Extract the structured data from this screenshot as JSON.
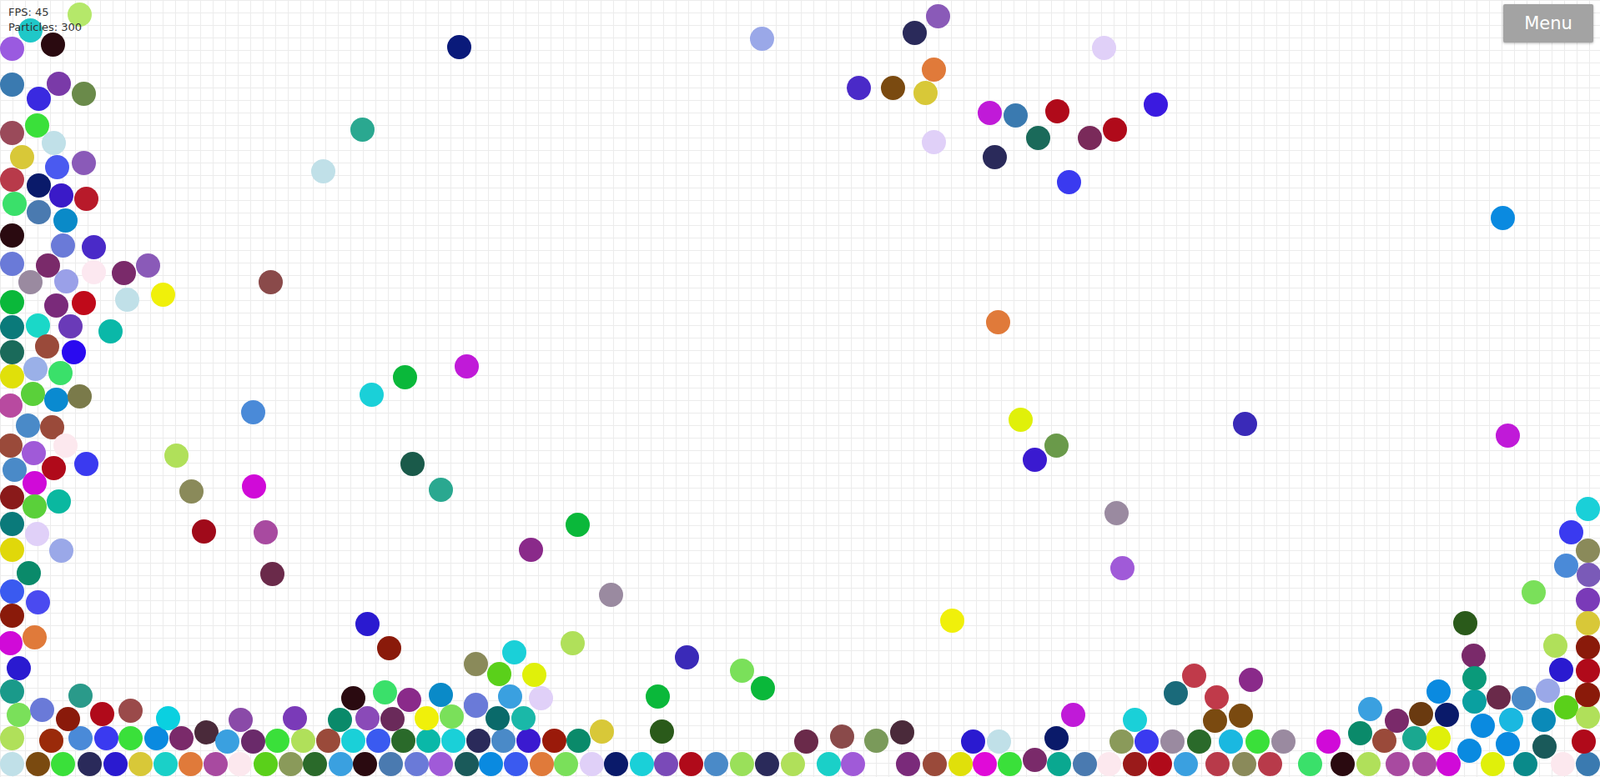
{
  "hud": {
    "fps": "FPS: 45",
    "particles": "Particles: 300"
  },
  "menu_button": {
    "label": "Menu"
  },
  "particles": [
    {
      "color": "#b5e86a"
    },
    {
      "color": "#1fc8c8"
    },
    {
      "color": "#9a5ae0"
    },
    {
      "color": "#2a0a10"
    },
    {
      "color": "#3a7ab0"
    },
    {
      "color": "#7a3aa8"
    },
    {
      "color": "#6a8a4a"
    },
    {
      "color": "#3a2ae0"
    },
    {
      "color": "#9a4a5a"
    },
    {
      "color": "#3ae03a"
    },
    {
      "color": "#c0e0e8"
    },
    {
      "color": "#d8c838"
    },
    {
      "color": "#4a5af0"
    },
    {
      "color": "#8a5ab8"
    },
    {
      "color": "#b83a4a"
    },
    {
      "color": "#0a1a6a"
    },
    {
      "color": "#3a1ac8"
    },
    {
      "color": "#b81a2a"
    },
    {
      "color": "#3ae06a"
    },
    {
      "color": "#4a7ab0"
    },
    {
      "color": "#0a8ac8"
    },
    {
      "color": "#2a0a10"
    },
    {
      "color": "#6a7ad8"
    },
    {
      "color": "#4a2ac8"
    },
    {
      "color": "#6a7ad8"
    },
    {
      "color": "#7a2a6a"
    },
    {
      "color": "#9a8aa0"
    },
    {
      "color": "#9aa0e8"
    },
    {
      "color": "#fce8f0"
    },
    {
      "color": "#7a2a6a"
    },
    {
      "color": "#8a5ab8"
    },
    {
      "color": "#0ab83a"
    },
    {
      "color": "#7a2a7a"
    },
    {
      "color": "#c00a1a"
    },
    {
      "color": "#c0e0e8"
    },
    {
      "color": "#f0f00a"
    },
    {
      "color": "#0a7a7a"
    },
    {
      "color": "#1ad8c8"
    },
    {
      "color": "#6a3ab8"
    },
    {
      "color": "#0ab8a8"
    },
    {
      "color": "#1a6a5a"
    },
    {
      "color": "#9a4a3a"
    },
    {
      "color": "#2a0af0"
    },
    {
      "color": "#e0e00a"
    },
    {
      "color": "#9ab0e8"
    },
    {
      "color": "#3ae06a"
    },
    {
      "color": "#b84aa0"
    },
    {
      "color": "#5ad03a"
    },
    {
      "color": "#0a8ad0"
    },
    {
      "color": "#7a7a4a"
    },
    {
      "color": "#4a8ac8"
    },
    {
      "color": "#9a4a3a"
    },
    {
      "color": "#9a4a3a"
    },
    {
      "color": "#a05ad8"
    },
    {
      "color": "#fce8ee"
    },
    {
      "color": "#4a8ac8"
    },
    {
      "color": "#b00a1a"
    },
    {
      "color": "#3a3af0"
    },
    {
      "color": "#d00ad8"
    },
    {
      "color": "#8a1a1a"
    },
    {
      "color": "#5ad03a"
    },
    {
      "color": "#0ab8a0"
    },
    {
      "color": "#0a7a7a"
    },
    {
      "color": "#e0d0f8"
    },
    {
      "color": "#e0d80a"
    },
    {
      "color": "#9aa8e8"
    },
    {
      "color": "#0a8a6a"
    },
    {
      "color": "#3a5af0"
    },
    {
      "color": "#4a4af0"
    },
    {
      "color": "#8a1a0a"
    },
    {
      "color": "#e07a3a"
    },
    {
      "color": "#d00ad8"
    },
    {
      "color": "#2a1ad0"
    },
    {
      "color": "#1a9a8a"
    },
    {
      "color": "#0a1a7a"
    },
    {
      "color": "#2aa890"
    },
    {
      "color": "#c0e0e8"
    },
    {
      "color": "#8a4a4a"
    },
    {
      "color": "#9aa8e8"
    },
    {
      "color": "#2a2a5a"
    },
    {
      "color": "#8a5ab8"
    },
    {
      "color": "#e07a3a"
    },
    {
      "color": "#4a2ac8"
    },
    {
      "color": "#7a4a10"
    },
    {
      "color": "#d8c838"
    },
    {
      "color": "#e0d0f8"
    },
    {
      "color": "#c01ad8"
    },
    {
      "color": "#3a7ab0"
    },
    {
      "color": "#b00a1a"
    },
    {
      "color": "#1a6a5a"
    },
    {
      "color": "#7a2a5a"
    },
    {
      "color": "#b00a1a"
    },
    {
      "color": "#3a1ae0"
    },
    {
      "color": "#e0d0f8"
    },
    {
      "color": "#2a2a5a"
    },
    {
      "color": "#3a3af0"
    },
    {
      "color": "#0a8ae0"
    },
    {
      "color": "#e07a3a"
    },
    {
      "color": "#c01ad8"
    },
    {
      "color": "#0ab83a"
    },
    {
      "color": "#1ad0d8"
    },
    {
      "color": "#4a8ad8"
    },
    {
      "color": "#b0e05a"
    },
    {
      "color": "#8a8a5a"
    },
    {
      "color": "#d00ad8"
    },
    {
      "color": "#a00a1a"
    },
    {
      "color": "#a84aa0"
    },
    {
      "color": "#6a2a4a"
    },
    {
      "color": "#1a5a4a"
    },
    {
      "color": "#2aa890"
    },
    {
      "color": "#0ab83a"
    },
    {
      "color": "#8a2a8a"
    },
    {
      "color": "#9a8aa0"
    },
    {
      "color": "#e0f00a"
    },
    {
      "color": "#6a9a4a"
    },
    {
      "color": "#3a1ad0"
    },
    {
      "color": "#3a2ab8"
    },
    {
      "color": "#c01ad8"
    },
    {
      "color": "#9a8aa0"
    },
    {
      "color": "#a05ad8"
    },
    {
      "color": "#f0f00a"
    },
    {
      "color": "#2a1ad0"
    },
    {
      "color": "#8a1a0a"
    },
    {
      "color": "#c0e0e8"
    },
    {
      "color": "#7a4a10"
    },
    {
      "color": "#3ae03a"
    },
    {
      "color": "#2a2a5a"
    },
    {
      "color": "#2a1ad0"
    },
    {
      "color": "#d8c838"
    },
    {
      "color": "#1ad0c8"
    },
    {
      "color": "#e07a3a"
    },
    {
      "color": "#a84aa0"
    },
    {
      "color": "#fce8ee"
    },
    {
      "color": "#5ad01a"
    },
    {
      "color": "#8a9a5a"
    },
    {
      "color": "#2a6a2a"
    },
    {
      "color": "#3aa0e0"
    },
    {
      "color": "#2a0a10"
    },
    {
      "color": "#4a7ab0"
    },
    {
      "color": "#6a7ad8"
    },
    {
      "color": "#a05ad8"
    },
    {
      "color": "#1a5a5a"
    },
    {
      "color": "#0a8ae0"
    },
    {
      "color": "#3a5af0"
    },
    {
      "color": "#e07a3a"
    },
    {
      "color": "#7ae05a"
    },
    {
      "color": "#e0d0f8"
    },
    {
      "color": "#0a1a6a"
    },
    {
      "color": "#1ad0d8"
    },
    {
      "color": "#7a4ab8"
    },
    {
      "color": "#b00a1a"
    },
    {
      "color": "#4a8ac8"
    },
    {
      "color": "#9ae05a"
    },
    {
      "color": "#2a2a5a"
    },
    {
      "color": "#b0e05a"
    },
    {
      "color": "#1ad0c8"
    },
    {
      "color": "#a05ad8"
    },
    {
      "color": "#7a2a7a"
    },
    {
      "color": "#9a4a3a"
    },
    {
      "color": "#e0e00a"
    },
    {
      "color": "#e00ad8"
    },
    {
      "color": "#3ae03a"
    },
    {
      "color": "#7a2a6a"
    },
    {
      "color": "#0aa890"
    },
    {
      "color": "#4a7ab0"
    },
    {
      "color": "#fce8ee"
    },
    {
      "color": "#9a1a1a"
    },
    {
      "color": "#b00a1a"
    },
    {
      "color": "#3aa0e0"
    },
    {
      "color": "#b83a4a"
    },
    {
      "color": "#8a8a5a"
    },
    {
      "color": "#b83a4a"
    },
    {
      "color": "#3ae06a"
    },
    {
      "color": "#2a0a10"
    },
    {
      "color": "#b0e05a"
    },
    {
      "color": "#a84aa0"
    },
    {
      "color": "#a84aa0"
    },
    {
      "color": "#d00ad8"
    },
    {
      "color": "#e0f00a"
    },
    {
      "color": "#0a8a8a"
    },
    {
      "color": "#fce8ee"
    },
    {
      "color": "#3a7ab0"
    },
    {
      "color": "#b0e05a"
    },
    {
      "color": "#9a2a0a"
    },
    {
      "color": "#4a8ad8"
    },
    {
      "color": "#3a3af0"
    },
    {
      "color": "#3ae03a"
    },
    {
      "color": "#0a8ae0"
    },
    {
      "color": "#7a2a6a"
    },
    {
      "color": "#4a2a3a"
    },
    {
      "color": "#3aa0e0"
    },
    {
      "color": "#6a2a6a"
    },
    {
      "color": "#3ae03a"
    },
    {
      "color": "#b0e05a"
    },
    {
      "color": "#9a4a3a"
    },
    {
      "color": "#1ad0d8"
    },
    {
      "color": "#3a5af0"
    },
    {
      "color": "#2a6a2a"
    },
    {
      "color": "#0ab8a8"
    },
    {
      "color": "#1ad0d8"
    },
    {
      "color": "#2a2a5a"
    },
    {
      "color": "#4a8ac8"
    },
    {
      "color": "#3a1ad0"
    },
    {
      "color": "#9a1a0a"
    },
    {
      "color": "#0a8a6a"
    },
    {
      "color": "#6a2a4a"
    },
    {
      "color": "#2a1ad0"
    },
    {
      "color": "#c0e0e8"
    },
    {
      "color": "#8a9a5a"
    },
    {
      "color": "#3a3af0"
    },
    {
      "color": "#9a8aa0"
    },
    {
      "color": "#2a6a2a"
    },
    {
      "color": "#1ab8e0"
    },
    {
      "color": "#3ae03a"
    },
    {
      "color": "#9a8aa0"
    },
    {
      "color": "#d00ad8"
    },
    {
      "color": "#0a8a6a"
    },
    {
      "color": "#9a4a3a"
    },
    {
      "color": "#1aa890"
    },
    {
      "color": "#e0f00a"
    },
    {
      "color": "#0a8ae0"
    },
    {
      "color": "#0a8ae0"
    },
    {
      "color": "#1a5a5a"
    },
    {
      "color": "#b00a1a"
    },
    {
      "color": "#7ae05a"
    },
    {
      "color": "#6a7ad8"
    },
    {
      "color": "#8a1a0a"
    },
    {
      "color": "#b00a1a"
    },
    {
      "color": "#9a4a4a"
    },
    {
      "color": "#0ad0e0"
    },
    {
      "color": "#8a4aa8"
    },
    {
      "color": "#7a3ab8"
    },
    {
      "color": "#0a8a6a"
    },
    {
      "color": "#8a4ab8"
    },
    {
      "color": "#6a2a5a"
    },
    {
      "color": "#f0f00a"
    },
    {
      "color": "#7ae05a"
    },
    {
      "color": "#6a7ad8"
    },
    {
      "color": "#0a6a6a"
    },
    {
      "color": "#1ab8a8"
    },
    {
      "color": "#d8c838"
    },
    {
      "color": "#2a5a1a"
    },
    {
      "color": "#8a4a4a"
    },
    {
      "color": "#7a9a5a"
    },
    {
      "color": "#4a2a3a"
    },
    {
      "color": "#0a1a6a"
    },
    {
      "color": "#c01ad8"
    },
    {
      "color": "#1ad0d8"
    },
    {
      "color": "#7a4a10"
    },
    {
      "color": "#7a4a10"
    },
    {
      "color": "#3aa0e0"
    },
    {
      "color": "#7a2a6a"
    },
    {
      "color": "#6a3a10"
    },
    {
      "color": "#0a1a6a"
    },
    {
      "color": "#0a8ae0"
    },
    {
      "color": "#1ab8e0"
    },
    {
      "color": "#0a8ab8"
    },
    {
      "color": "#5ad01a"
    },
    {
      "color": "#b0e05a"
    },
    {
      "color": "#2a9a8a"
    },
    {
      "color": "#2a0a10"
    },
    {
      "color": "#3ae06a"
    },
    {
      "color": "#8a2a8a"
    },
    {
      "color": "#0a8ac8"
    },
    {
      "color": "#6a7ad8"
    },
    {
      "color": "#3aa0e0"
    },
    {
      "color": "#e0d0f8"
    },
    {
      "color": "#0ab83a"
    },
    {
      "color": "#c03a4a"
    },
    {
      "color": "#1a6a7a"
    },
    {
      "color": "#0a8ae0"
    },
    {
      "color": "#0aa0a0"
    },
    {
      "color": "#6a2a4a"
    },
    {
      "color": "#4a8ac8"
    },
    {
      "color": "#9aa8e8"
    },
    {
      "color": "#9a1a0a"
    },
    {
      "color": "#8a8a5a"
    },
    {
      "color": "#5ad01a"
    },
    {
      "color": "#1ad0d8"
    },
    {
      "color": "#e0f00a"
    },
    {
      "color": "#b0e05a"
    },
    {
      "color": "#3a2ab8"
    },
    {
      "color": "#7ae05a"
    },
    {
      "color": "#0ab83a"
    },
    {
      "color": "#c03a4a"
    },
    {
      "color": "#8a2a8a"
    },
    {
      "color": "#7a2a6a"
    },
    {
      "color": "#0a9a7a"
    },
    {
      "color": "#2a5a1a"
    },
    {
      "color": "#1ad0d8"
    },
    {
      "color": "#3a3af0"
    },
    {
      "color": "#8a8a5a"
    },
    {
      "color": "#4a8ad8"
    },
    {
      "color": "#7a5ab8"
    },
    {
      "color": "#7ae05a"
    },
    {
      "color": "#7a3ab8"
    },
    {
      "color": "#d8c838"
    },
    {
      "color": "#b0e05a"
    },
    {
      "color": "#8a1a0a"
    },
    {
      "color": "#2a1ad0"
    },
    {
      "color": "#b00a1a"
    },
    {
      "color": "#8a1a0a"
    }
  ]
}
